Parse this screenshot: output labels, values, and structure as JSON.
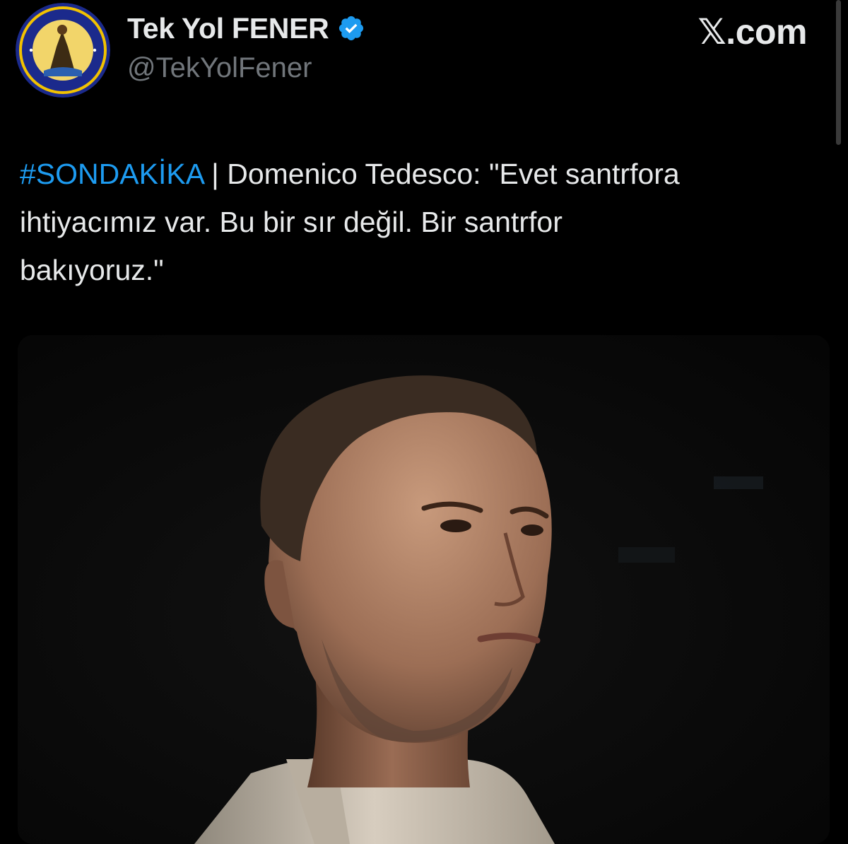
{
  "source_mark": "𝕏.com",
  "author": {
    "display_name": "Tek Yol FENER",
    "handle": "@TekYolFener",
    "verified": true,
    "avatar_icon": "fenerbahce-style-club-badge"
  },
  "tweet": {
    "hashtag": "#SONDAKİKA",
    "separator": " | ",
    "line1_rest": "Domenico Tedesco: \"Evet santrfora",
    "line2": "ihtiyacımız var. Bu bir sır değil. Bir santrfor",
    "line3": "bakıyoruz.\""
  },
  "media": {
    "kind": "photo",
    "subject": "portrait-photo"
  },
  "colors": {
    "background": "#000000",
    "text": "#e7e9ea",
    "secondary_text": "#71767b",
    "link": "#1d9bf0",
    "verified": "#1d9bf0"
  }
}
